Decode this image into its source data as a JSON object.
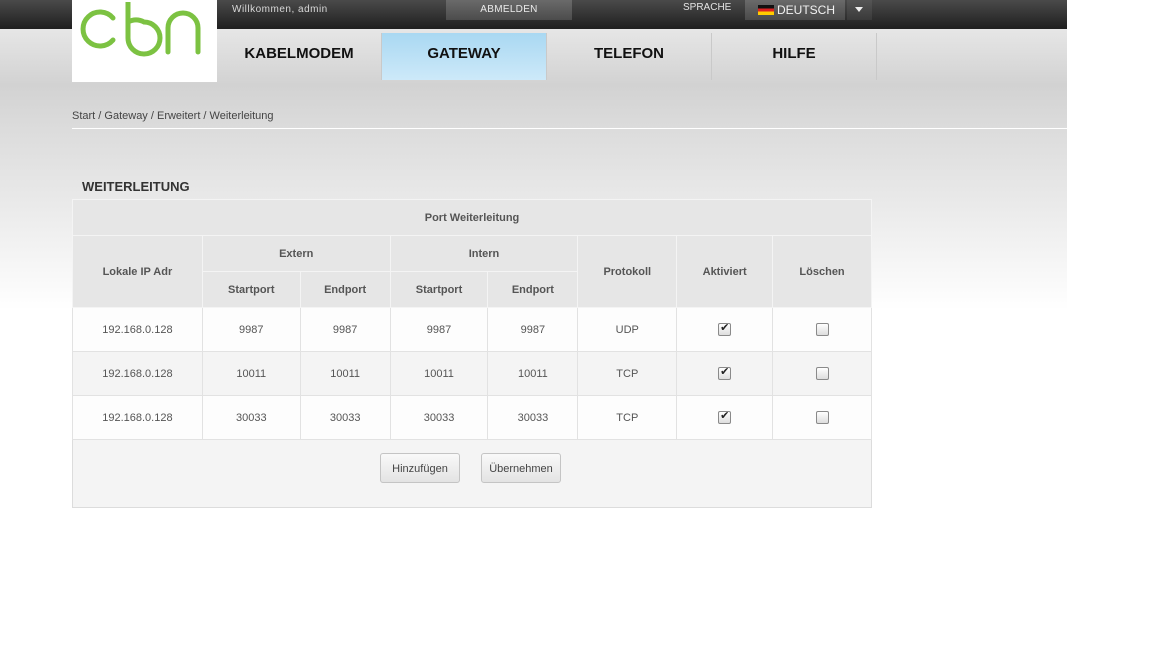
{
  "header": {
    "logo_text": "cbn",
    "welcome": "Willkommen, admin",
    "logout_label": "ABMELDEN",
    "language_label": "SPRACHE",
    "language_value": "DEUTSCH"
  },
  "nav": {
    "items": [
      {
        "label": "KABELMODEM"
      },
      {
        "label": "GATEWAY",
        "active": true
      },
      {
        "label": "TELEFON"
      },
      {
        "label": "HILFE"
      }
    ]
  },
  "breadcrumb": "Start / Gateway / Erweitert / Weiterleitung",
  "section_title": "WEITERLEITUNG",
  "table": {
    "caption": "Port Weiterleitung",
    "headers": {
      "local_ip": "Lokale IP Adr",
      "extern": "Extern",
      "intern": "Intern",
      "startport": "Startport",
      "endport": "Endport",
      "protocol": "Protokoll",
      "enabled": "Aktiviert",
      "delete": "Löschen"
    },
    "rows": [
      {
        "ip": "192.168.0.128",
        "ext_start": "9987",
        "ext_end": "9987",
        "int_start": "9987",
        "int_end": "9987",
        "protocol": "UDP",
        "enabled": true,
        "delete": false
      },
      {
        "ip": "192.168.0.128",
        "ext_start": "10011",
        "ext_end": "10011",
        "int_start": "10011",
        "int_end": "10011",
        "protocol": "TCP",
        "enabled": true,
        "delete": false
      },
      {
        "ip": "192.168.0.128",
        "ext_start": "30033",
        "ext_end": "30033",
        "int_start": "30033",
        "int_end": "30033",
        "protocol": "TCP",
        "enabled": true,
        "delete": false
      }
    ]
  },
  "buttons": {
    "add_label": "Hinzufügen",
    "apply_label": "Übernehmen"
  },
  "colors": {
    "brand_green": "#7cc242",
    "nav_active": "#b8e0f6"
  }
}
